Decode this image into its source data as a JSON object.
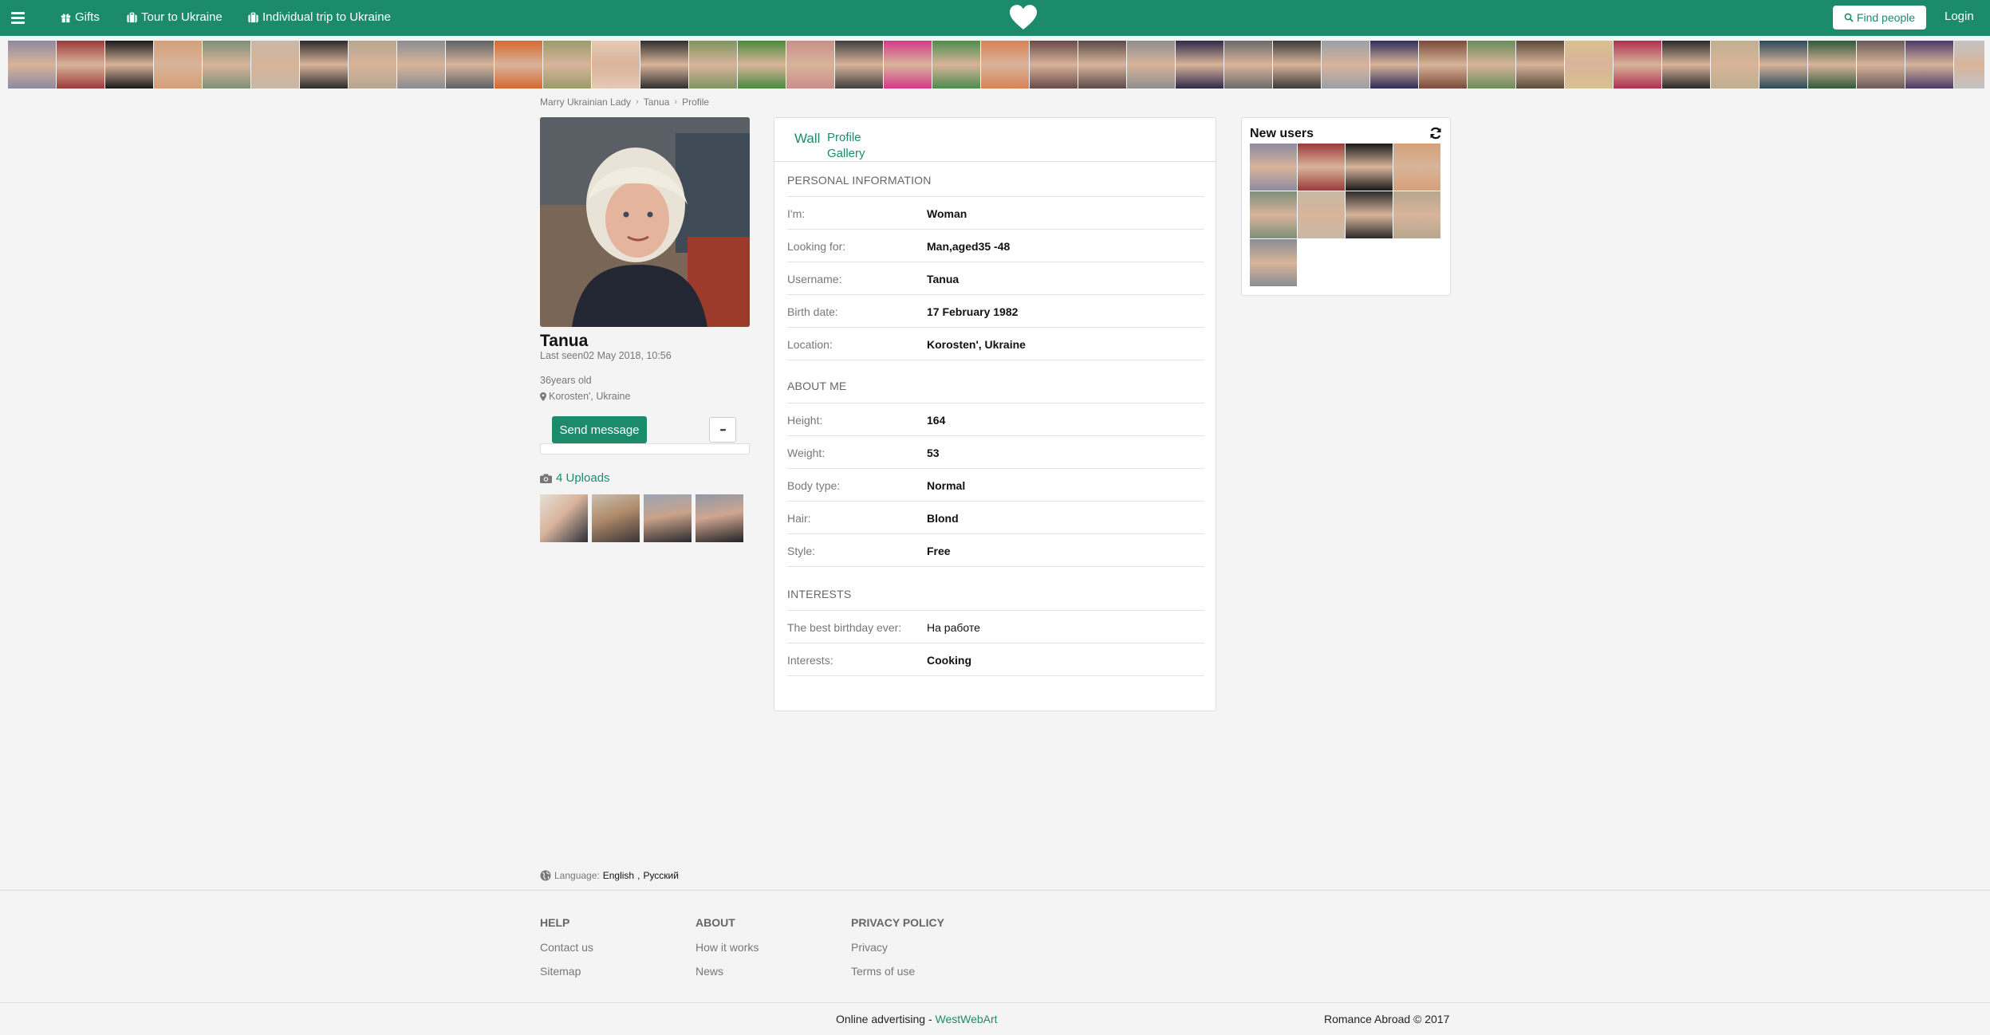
{
  "nav": {
    "menu_icon": "hamburger-icon",
    "links": [
      {
        "label": "Gifts",
        "icon": "gift-icon"
      },
      {
        "label": "Tour to Ukraine",
        "icon": "suitcase-icon"
      },
      {
        "label": "Individual trip to Ukraine",
        "icon": "suitcase-icon"
      }
    ],
    "logo_icon": "heart-icon",
    "find_people": "Find people",
    "login": "Login"
  },
  "strip_photos": [
    "#8d8aa0",
    "#9d3a3a",
    "#1a1a1a",
    "#d4a07a",
    "#7e8f7a",
    "#c7b8a6",
    "#2b2b2b",
    "#b7a68f",
    "#8a8d93",
    "#5c6166",
    "#d8682f",
    "#9a9c6b",
    "#e6c9b5",
    "#2f2f2f",
    "#7f9460",
    "#4a8a3d",
    "#c98f8a",
    "#3f3f3f",
    "#d43a8a",
    "#4d8c4d",
    "#d98254",
    "#6a4a4a",
    "#5b4b49",
    "#8e8e8e",
    "#2e2a4a",
    "#6a6a6a",
    "#3a3a3a",
    "#9aa0a8",
    "#2d2d5a",
    "#7b4a3a",
    "#6a8d5a",
    "#5a4a3a",
    "#d8c090",
    "#b03050",
    "#2a2a2a",
    "#c0b090",
    "#2a4a5a",
    "#2f5a3a",
    "#6a5a5a",
    "#4a3a6a",
    "#c3c3c3"
  ],
  "breadcrumb": [
    "Marry Ukrainian Lady",
    "Tanua",
    "Profile"
  ],
  "profile": {
    "name": "Tanua",
    "last_seen": "Last seen02 May 2018, 10:56",
    "age": "36years old",
    "location": "Korosten', Ukraine",
    "send_message": "Send message",
    "more": "•••",
    "uploads": "4 Uploads"
  },
  "tabs": {
    "wall": "Wall",
    "profile": "Profile",
    "gallery": "Gallery"
  },
  "sections": {
    "personal": {
      "title": "PERSONAL INFORMATION",
      "rows": [
        {
          "label": "I'm:",
          "value": "Woman"
        },
        {
          "label": "Looking for:",
          "value": "Man,aged35 -48"
        },
        {
          "label": "Username:",
          "value": "Tanua"
        },
        {
          "label": "Birth date:",
          "value": "17 February 1982"
        },
        {
          "label": "Location:",
          "value": "Korosten', Ukraine"
        }
      ]
    },
    "about": {
      "title": "ABOUT ME",
      "rows": [
        {
          "label": "Height:",
          "value": "164"
        },
        {
          "label": "Weight:",
          "value": "53"
        },
        {
          "label": "Body type:",
          "value": "Normal"
        },
        {
          "label": "Hair:",
          "value": "Blond"
        },
        {
          "label": "Style:",
          "value": "Free"
        }
      ]
    },
    "interests": {
      "title": "INTERESTS",
      "rows": [
        {
          "label": "The best birthday ever:",
          "value": "На работе"
        },
        {
          "label": "Interests:",
          "value": "Cooking"
        }
      ]
    }
  },
  "new_users": {
    "title": "New users",
    "refresh_icon": "refresh-icon"
  },
  "language": {
    "label": "Language:",
    "en": "English",
    "ru": "Русский"
  },
  "footer": {
    "help": {
      "title": "HELP",
      "links": [
        "Contact us",
        "Sitemap"
      ]
    },
    "about": {
      "title": "ABOUT",
      "links": [
        "How it works",
        "News"
      ]
    },
    "privacy": {
      "title": "PRIVACY POLICY",
      "links": [
        "Privacy",
        "Terms of use"
      ]
    },
    "adv_text": "Online advertising - ",
    "adv_link": "WestWebArt",
    "copyright": "Romance Abroad © 2017"
  }
}
